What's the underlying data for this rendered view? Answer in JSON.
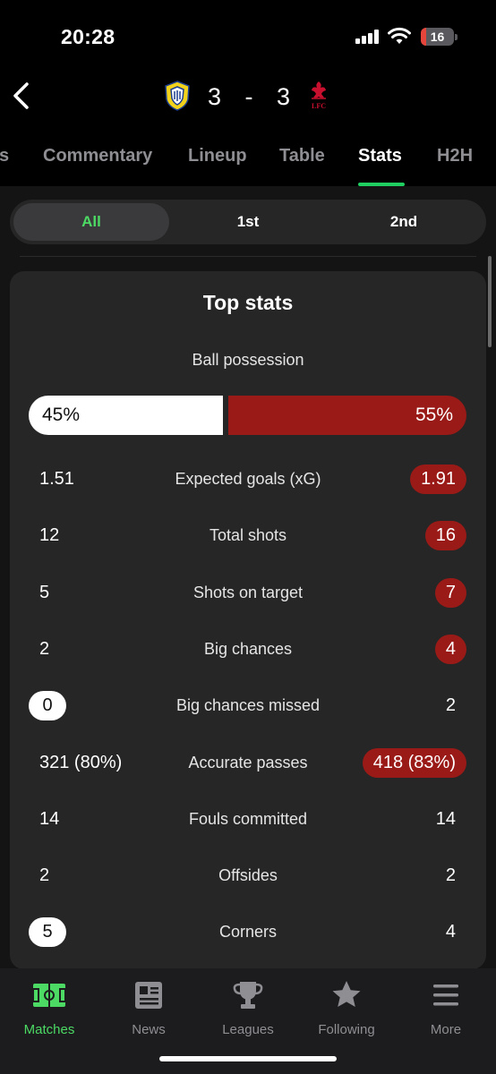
{
  "status_bar": {
    "time": "20:28",
    "battery": "16"
  },
  "header": {
    "home_score": "3",
    "separator": "-",
    "away_score": "3",
    "away_badge_text": "LFC"
  },
  "tabs": [
    {
      "label": "s"
    },
    {
      "label": "Commentary"
    },
    {
      "label": "Lineup"
    },
    {
      "label": "Table"
    },
    {
      "label": "Stats",
      "active": true
    },
    {
      "label": "H2H"
    }
  ],
  "periods": [
    {
      "label": "All",
      "active": true
    },
    {
      "label": "1st"
    },
    {
      "label": "2nd"
    }
  ],
  "top_stats": {
    "title": "Top stats",
    "possession": {
      "label": "Ball possession",
      "home": "45%",
      "away": "55%",
      "home_fraction": 0.45
    },
    "rows": [
      {
        "label": "Expected goals (xG)",
        "home": "1.51",
        "away": "1.91",
        "highlight": "away"
      },
      {
        "label": "Total shots",
        "home": "12",
        "away": "16",
        "highlight": "away"
      },
      {
        "label": "Shots on target",
        "home": "5",
        "away": "7",
        "highlight": "away"
      },
      {
        "label": "Big chances",
        "home": "2",
        "away": "4",
        "highlight": "away"
      },
      {
        "label": "Big chances missed",
        "home": "0",
        "away": "2",
        "highlight": "home"
      },
      {
        "label": "Accurate passes",
        "home": "321 (80%)",
        "away": "418 (83%)",
        "highlight": "away"
      },
      {
        "label": "Fouls committed",
        "home": "14",
        "away": "14",
        "highlight": "none"
      },
      {
        "label": "Offsides",
        "home": "2",
        "away": "2",
        "highlight": "none"
      },
      {
        "label": "Corners",
        "home": "5",
        "away": "4",
        "highlight": "home"
      }
    ]
  },
  "bottom_nav": [
    {
      "label": "Matches",
      "icon": "pitch-icon",
      "active": true
    },
    {
      "label": "News",
      "icon": "newspaper-icon"
    },
    {
      "label": "Leagues",
      "icon": "trophy-icon"
    },
    {
      "label": "Following",
      "icon": "star-icon"
    },
    {
      "label": "More",
      "icon": "menu-icon"
    }
  ],
  "colors": {
    "accent": "#4cd964",
    "away_team": "#9a1a17",
    "card": "#262626",
    "background": "#141414"
  }
}
